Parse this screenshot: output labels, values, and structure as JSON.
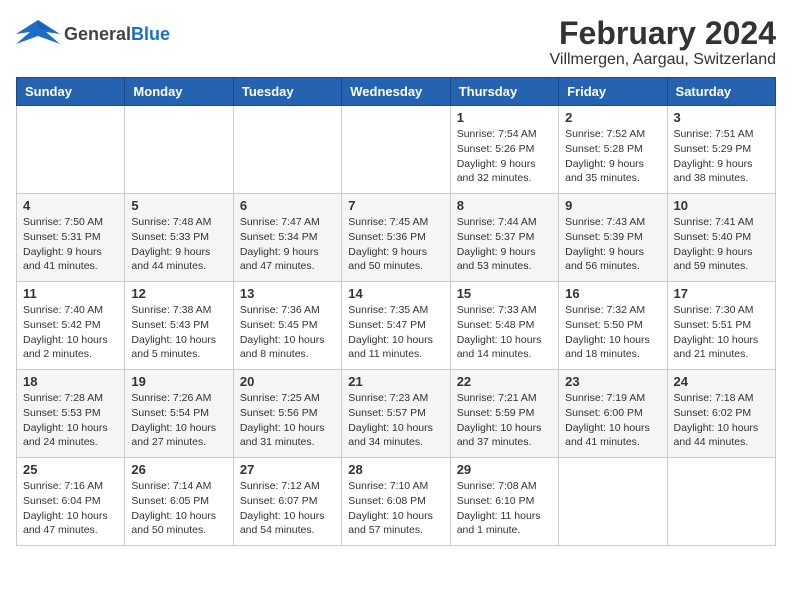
{
  "header": {
    "logo_general": "General",
    "logo_blue": "Blue",
    "title": "February 2024",
    "subtitle": "Villmergen, Aargau, Switzerland"
  },
  "days_of_week": [
    "Sunday",
    "Monday",
    "Tuesday",
    "Wednesday",
    "Thursday",
    "Friday",
    "Saturday"
  ],
  "weeks": [
    [
      {
        "num": "",
        "info": ""
      },
      {
        "num": "",
        "info": ""
      },
      {
        "num": "",
        "info": ""
      },
      {
        "num": "",
        "info": ""
      },
      {
        "num": "1",
        "info": "Sunrise: 7:54 AM\nSunset: 5:26 PM\nDaylight: 9 hours\nand 32 minutes."
      },
      {
        "num": "2",
        "info": "Sunrise: 7:52 AM\nSunset: 5:28 PM\nDaylight: 9 hours\nand 35 minutes."
      },
      {
        "num": "3",
        "info": "Sunrise: 7:51 AM\nSunset: 5:29 PM\nDaylight: 9 hours\nand 38 minutes."
      }
    ],
    [
      {
        "num": "4",
        "info": "Sunrise: 7:50 AM\nSunset: 5:31 PM\nDaylight: 9 hours\nand 41 minutes."
      },
      {
        "num": "5",
        "info": "Sunrise: 7:48 AM\nSunset: 5:33 PM\nDaylight: 9 hours\nand 44 minutes."
      },
      {
        "num": "6",
        "info": "Sunrise: 7:47 AM\nSunset: 5:34 PM\nDaylight: 9 hours\nand 47 minutes."
      },
      {
        "num": "7",
        "info": "Sunrise: 7:45 AM\nSunset: 5:36 PM\nDaylight: 9 hours\nand 50 minutes."
      },
      {
        "num": "8",
        "info": "Sunrise: 7:44 AM\nSunset: 5:37 PM\nDaylight: 9 hours\nand 53 minutes."
      },
      {
        "num": "9",
        "info": "Sunrise: 7:43 AM\nSunset: 5:39 PM\nDaylight: 9 hours\nand 56 minutes."
      },
      {
        "num": "10",
        "info": "Sunrise: 7:41 AM\nSunset: 5:40 PM\nDaylight: 9 hours\nand 59 minutes."
      }
    ],
    [
      {
        "num": "11",
        "info": "Sunrise: 7:40 AM\nSunset: 5:42 PM\nDaylight: 10 hours\nand 2 minutes."
      },
      {
        "num": "12",
        "info": "Sunrise: 7:38 AM\nSunset: 5:43 PM\nDaylight: 10 hours\nand 5 minutes."
      },
      {
        "num": "13",
        "info": "Sunrise: 7:36 AM\nSunset: 5:45 PM\nDaylight: 10 hours\nand 8 minutes."
      },
      {
        "num": "14",
        "info": "Sunrise: 7:35 AM\nSunset: 5:47 PM\nDaylight: 10 hours\nand 11 minutes."
      },
      {
        "num": "15",
        "info": "Sunrise: 7:33 AM\nSunset: 5:48 PM\nDaylight: 10 hours\nand 14 minutes."
      },
      {
        "num": "16",
        "info": "Sunrise: 7:32 AM\nSunset: 5:50 PM\nDaylight: 10 hours\nand 18 minutes."
      },
      {
        "num": "17",
        "info": "Sunrise: 7:30 AM\nSunset: 5:51 PM\nDaylight: 10 hours\nand 21 minutes."
      }
    ],
    [
      {
        "num": "18",
        "info": "Sunrise: 7:28 AM\nSunset: 5:53 PM\nDaylight: 10 hours\nand 24 minutes."
      },
      {
        "num": "19",
        "info": "Sunrise: 7:26 AM\nSunset: 5:54 PM\nDaylight: 10 hours\nand 27 minutes."
      },
      {
        "num": "20",
        "info": "Sunrise: 7:25 AM\nSunset: 5:56 PM\nDaylight: 10 hours\nand 31 minutes."
      },
      {
        "num": "21",
        "info": "Sunrise: 7:23 AM\nSunset: 5:57 PM\nDaylight: 10 hours\nand 34 minutes."
      },
      {
        "num": "22",
        "info": "Sunrise: 7:21 AM\nSunset: 5:59 PM\nDaylight: 10 hours\nand 37 minutes."
      },
      {
        "num": "23",
        "info": "Sunrise: 7:19 AM\nSunset: 6:00 PM\nDaylight: 10 hours\nand 41 minutes."
      },
      {
        "num": "24",
        "info": "Sunrise: 7:18 AM\nSunset: 6:02 PM\nDaylight: 10 hours\nand 44 minutes."
      }
    ],
    [
      {
        "num": "25",
        "info": "Sunrise: 7:16 AM\nSunset: 6:04 PM\nDaylight: 10 hours\nand 47 minutes."
      },
      {
        "num": "26",
        "info": "Sunrise: 7:14 AM\nSunset: 6:05 PM\nDaylight: 10 hours\nand 50 minutes."
      },
      {
        "num": "27",
        "info": "Sunrise: 7:12 AM\nSunset: 6:07 PM\nDaylight: 10 hours\nand 54 minutes."
      },
      {
        "num": "28",
        "info": "Sunrise: 7:10 AM\nSunset: 6:08 PM\nDaylight: 10 hours\nand 57 minutes."
      },
      {
        "num": "29",
        "info": "Sunrise: 7:08 AM\nSunset: 6:10 PM\nDaylight: 11 hours\nand 1 minute."
      },
      {
        "num": "",
        "info": ""
      },
      {
        "num": "",
        "info": ""
      }
    ]
  ]
}
